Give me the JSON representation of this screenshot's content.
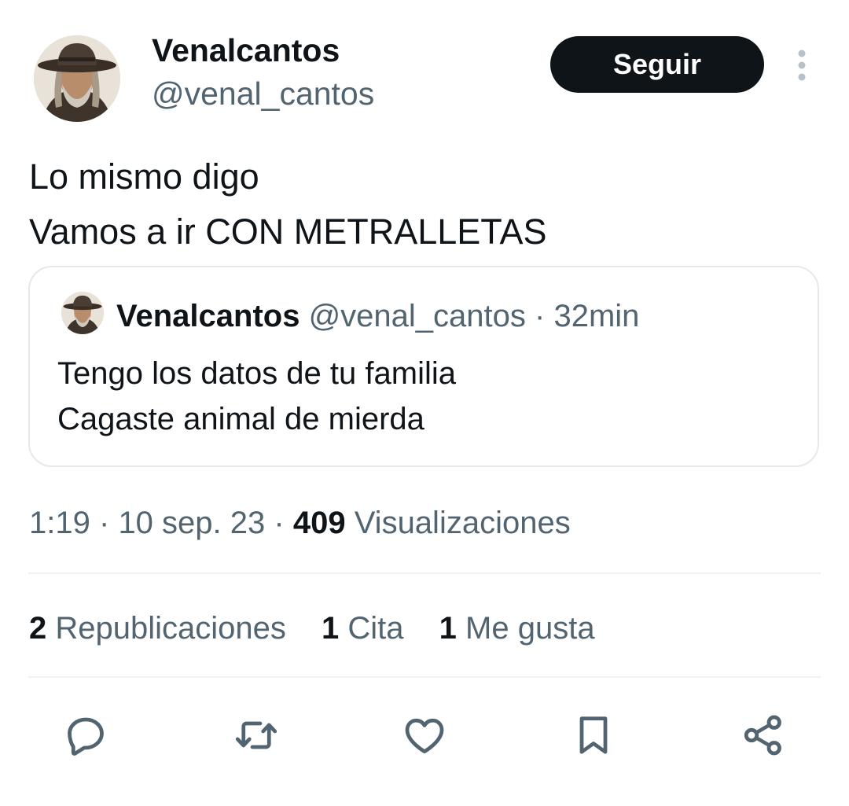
{
  "author": {
    "display_name": "Venalcantos",
    "handle": "@venal_cantos",
    "avatar_icon": "cowboy-portrait-avatar"
  },
  "follow_button": {
    "label": "Seguir"
  },
  "more_menu": {
    "icon": "vertical-dots-icon"
  },
  "tweet": {
    "lines": [
      "Lo mismo digo",
      "Vamos a ir CON METRALLETAS"
    ]
  },
  "quoted_tweet": {
    "display_name": "Venalcantos",
    "handle": "@venal_cantos",
    "separator": "·",
    "time": "32min",
    "lines": [
      "Tengo los datos de tu familia",
      "Cagaste animal de mierda"
    ]
  },
  "meta": {
    "time": "1:19",
    "date": "10 sep. 23",
    "separator": "·",
    "views_count": "409",
    "views_label": "Visualizaciones"
  },
  "stats": {
    "reposts": {
      "count": "2",
      "label": "Republicaciones"
    },
    "quotes": {
      "count": "1",
      "label": "Cita"
    },
    "likes": {
      "count": "1",
      "label": "Me gusta"
    }
  },
  "actions": [
    {
      "name": "reply",
      "icon": "reply-icon"
    },
    {
      "name": "repost",
      "icon": "repost-icon"
    },
    {
      "name": "like",
      "icon": "heart-icon"
    },
    {
      "name": "bookmark",
      "icon": "bookmark-icon"
    },
    {
      "name": "share",
      "icon": "share-icon"
    }
  ],
  "colors": {
    "text_primary": "#0f1419",
    "text_secondary": "#536471",
    "border": "#eff3f4",
    "follow_bg": "#0f1419"
  }
}
